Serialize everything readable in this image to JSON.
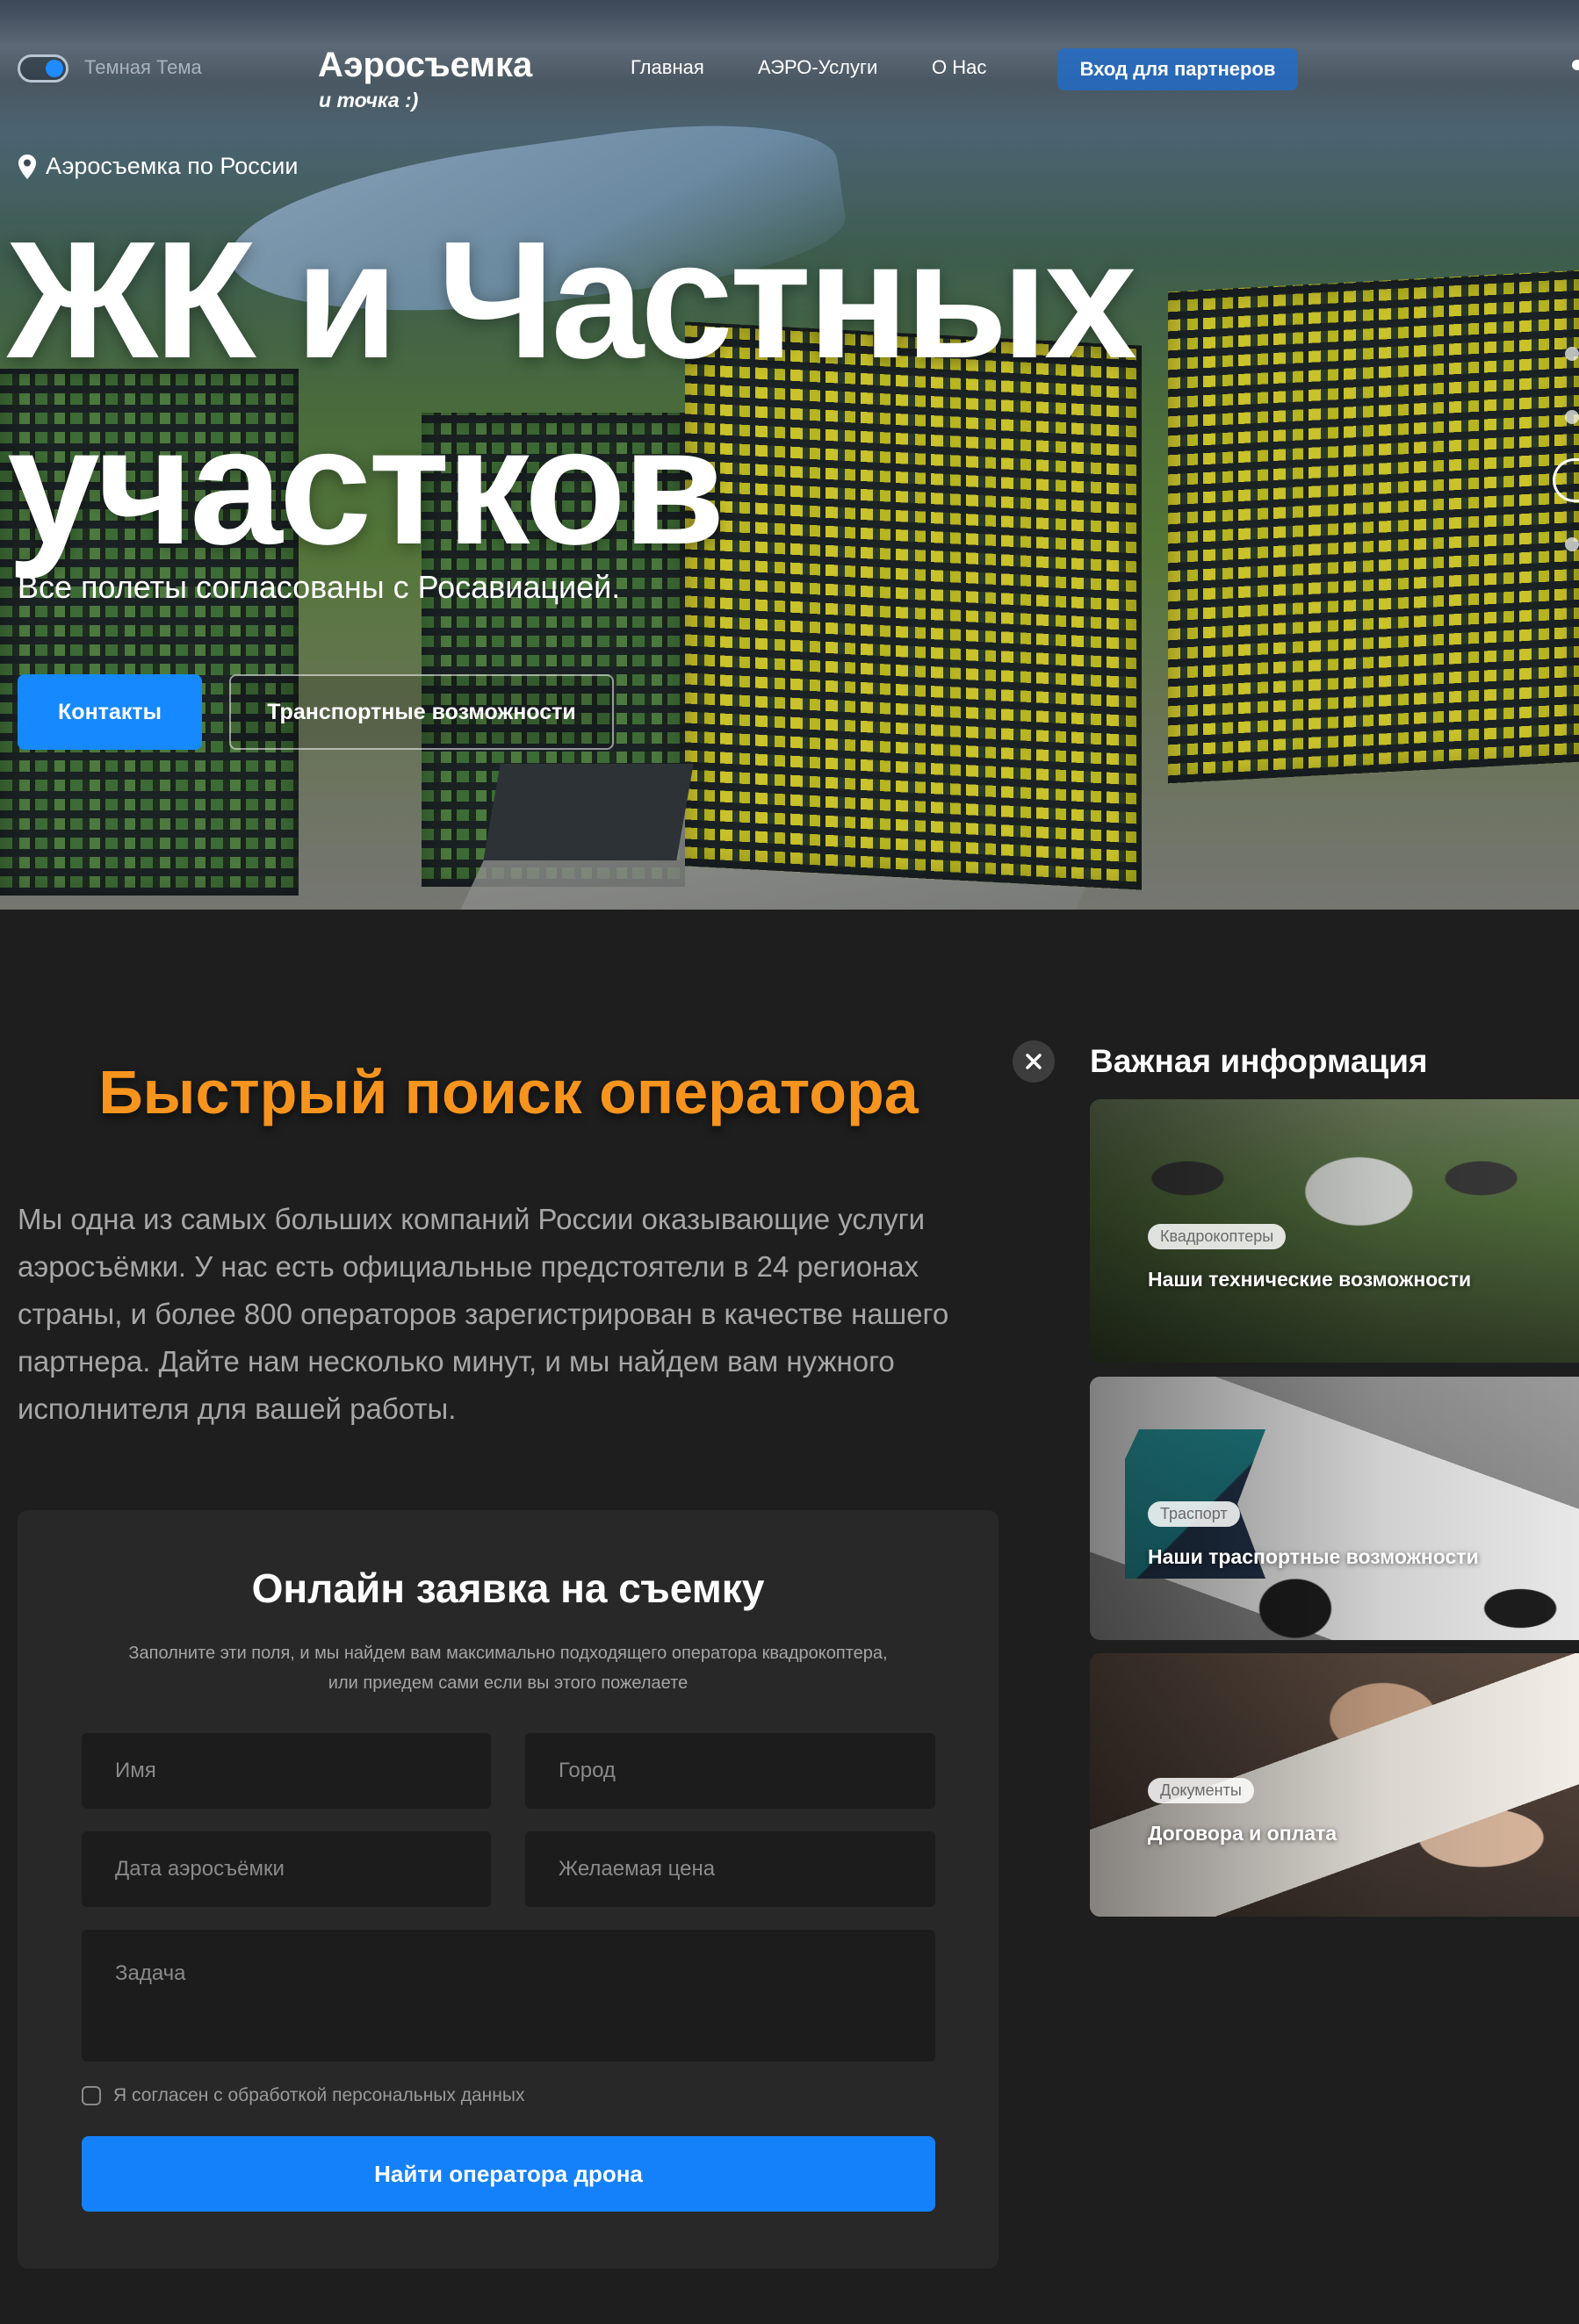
{
  "header": {
    "theme_toggle_label": "Темная Тема",
    "logo_main": "Аэросъемка",
    "logo_sub": "и точка :)",
    "nav": [
      {
        "label": "Главная"
      },
      {
        "label": "АЭРО-Услуги"
      },
      {
        "label": "О Нас"
      }
    ],
    "partner_button": "Вход для партнеров"
  },
  "hero": {
    "location": "Аэросъемка по России",
    "title_line1": "ЖК и Частных",
    "title_line2": "участков",
    "subtitle": "Все полеты согласованы с Росавиацией.",
    "btn_contacts": "Контакты",
    "btn_transport": "Транспортные возможности"
  },
  "search": {
    "title": "Быстрый поиск оператора",
    "intro": "Мы одна из самых больших компаний России оказывающие услуги аэросъёмки. У нас есть официальные предстоятели в 24 регионах страны, и более 800 операторов зарегистрирован в качестве нашего партнера. Дайте нам несколько минут, и мы найдем вам нужного исполнителя для вашей работы."
  },
  "form": {
    "title": "Онлайн заявка на съемку",
    "note_line1": "Заполните эти поля, и мы найдем вам максимально подходящего оператора квадрокоптера,",
    "note_line2": "или приедем сами если вы этого пожелаете",
    "fields": {
      "name": "Имя",
      "city": "Город",
      "date": "Дата аэросъёмки",
      "price": "Желаемая цена",
      "task": "Задача"
    },
    "consent": "Я согласен с обработкой персональных данных",
    "submit": "Найти оператора дрона"
  },
  "info": {
    "heading": "Важная информация",
    "cards": [
      {
        "tag": "Квадрокоптеры",
        "title": "Наши технические возможности"
      },
      {
        "tag": "Траспорт",
        "title": "Наши траспортные возможности"
      },
      {
        "tag": "Документы",
        "title": "Договора и оплата"
      }
    ]
  },
  "colors": {
    "accent_blue": "#1689ff",
    "accent_orange": "#f7941d",
    "background": "#1e1e1e"
  }
}
